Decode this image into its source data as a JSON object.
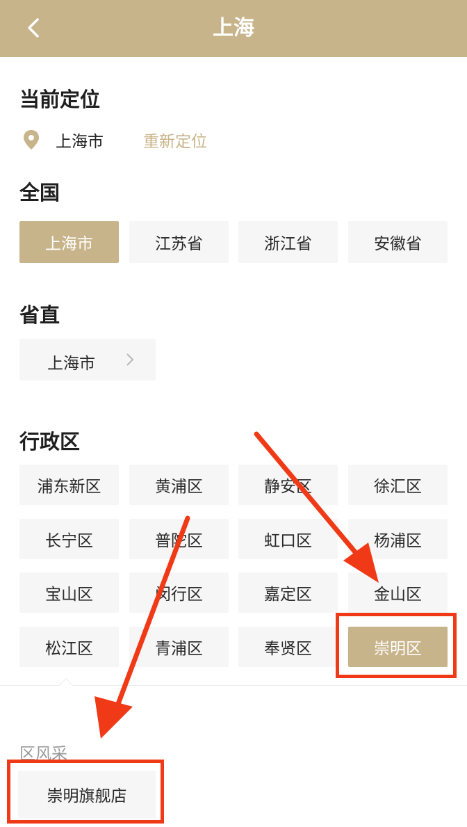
{
  "header": {
    "title": "上海",
    "back_icon": "chevron-left-icon"
  },
  "current_location": {
    "heading": "当前定位",
    "city": "上海市",
    "relocate_label": "重新定位",
    "pin_icon": "location-pin-icon"
  },
  "nation": {
    "heading": "全国",
    "items": [
      {
        "label": "上海市",
        "selected": true
      },
      {
        "label": "江苏省",
        "selected": false
      },
      {
        "label": "浙江省",
        "selected": false
      },
      {
        "label": "安徽省",
        "selected": false
      }
    ]
  },
  "province_direct": {
    "heading": "省直",
    "item": "上海市",
    "chevron_icon": "chevron-right-icon"
  },
  "districts": {
    "heading": "行政区",
    "items": [
      {
        "label": "浦东新区",
        "selected": false
      },
      {
        "label": "黄浦区",
        "selected": false
      },
      {
        "label": "静安区",
        "selected": false
      },
      {
        "label": "徐汇区",
        "selected": false
      },
      {
        "label": "长宁区",
        "selected": false
      },
      {
        "label": "普陀区",
        "selected": false
      },
      {
        "label": "虹口区",
        "selected": false
      },
      {
        "label": "杨浦区",
        "selected": false
      },
      {
        "label": "宝山区",
        "selected": false
      },
      {
        "label": "闵行区",
        "selected": false
      },
      {
        "label": "嘉定区",
        "selected": false
      },
      {
        "label": "金山区",
        "selected": false
      },
      {
        "label": "松江区",
        "selected": false
      },
      {
        "label": "青浦区",
        "selected": false
      },
      {
        "label": "奉贤区",
        "selected": false
      },
      {
        "label": "崇明区",
        "selected": true
      }
    ]
  },
  "district_showcase": {
    "heading": "区风采",
    "store": "崇明旗舰店"
  },
  "colors": {
    "gold": "#c8b48a",
    "chip_bg": "#f6f6f6",
    "annotation_red": "#f03a17"
  }
}
